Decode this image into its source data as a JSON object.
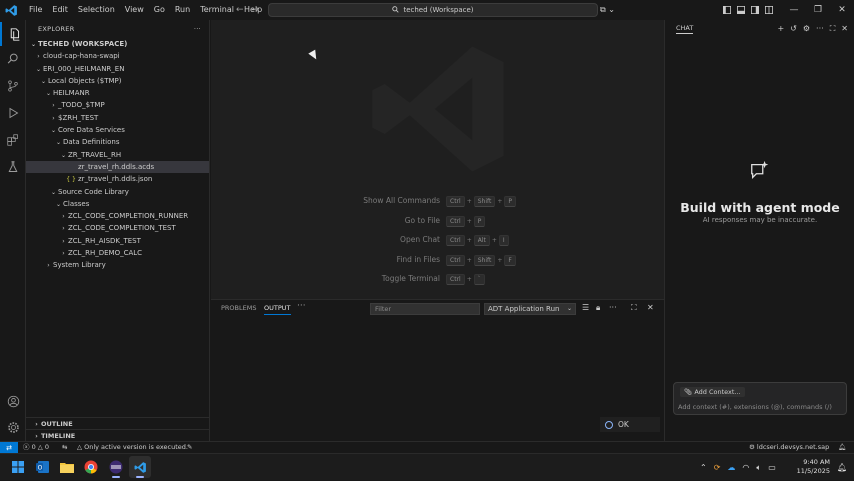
{
  "titlebar": {
    "menu": [
      "File",
      "Edit",
      "Selection",
      "View",
      "Go",
      "Run",
      "Terminal",
      "Help"
    ],
    "search_text": "teched (Workspace)"
  },
  "explorer": {
    "title": "EXPLORER",
    "workspace": "TECHED (WORKSPACE)",
    "items": [
      {
        "label": "cloud-cap-hana-swapi",
        "depth": 1,
        "chev": ">"
      },
      {
        "label": "ERI_000_HEILMANR_EN",
        "depth": 1,
        "chev": "v"
      },
      {
        "label": "Local Objects ($TMP)",
        "depth": 2,
        "chev": "v"
      },
      {
        "label": "HEILMANR",
        "depth": 3,
        "chev": "v"
      },
      {
        "label": "_TODO_$TMP",
        "depth": 4,
        "chev": ">"
      },
      {
        "label": "$ZRH_TEST",
        "depth": 4,
        "chev": ">"
      },
      {
        "label": "Core Data Services",
        "depth": 4,
        "chev": "v"
      },
      {
        "label": "Data Definitions",
        "depth": 5,
        "chev": "v"
      },
      {
        "label": "ZR_TRAVEL_RH",
        "depth": 6,
        "chev": "v"
      },
      {
        "label": "zr_travel_rh.ddls.acds",
        "depth": 7,
        "chev": "",
        "selected": true
      },
      {
        "label": "zr_travel_rh.ddls.json",
        "depth": 7,
        "chev": "",
        "json": true
      },
      {
        "label": "Source Code Library",
        "depth": 4,
        "chev": "v"
      },
      {
        "label": "Classes",
        "depth": 5,
        "chev": "v"
      },
      {
        "label": "ZCL_CODE_COMPLETION_RUNNER",
        "depth": 6,
        "chev": ">"
      },
      {
        "label": "ZCL_CODE_COMPLETION_TEST",
        "depth": 6,
        "chev": ">"
      },
      {
        "label": "ZCL_RH_AISDK_TEST",
        "depth": 6,
        "chev": ">"
      },
      {
        "label": "ZCL_RH_DEMO_CALC",
        "depth": 6,
        "chev": ">"
      },
      {
        "label": "System Library",
        "depth": 3,
        "chev": ">"
      }
    ],
    "outline": "OUTLINE",
    "timeline": "TIMELINE"
  },
  "editor": {
    "shortcuts": [
      {
        "label": "Show All Commands",
        "keys": [
          "Ctrl",
          "Shift",
          "P"
        ]
      },
      {
        "label": "Go to File",
        "keys": [
          "Ctrl",
          "P"
        ]
      },
      {
        "label": "Open Chat",
        "keys": [
          "Ctrl",
          "Alt",
          "I"
        ]
      },
      {
        "label": "Find in Files",
        "keys": [
          "Ctrl",
          "Shift",
          "F"
        ]
      },
      {
        "label": "Toggle Terminal",
        "keys": [
          "Ctrl",
          "`"
        ]
      }
    ]
  },
  "panel": {
    "tabs": [
      "PROBLEMS",
      "OUTPUT"
    ],
    "active_tab": "OUTPUT",
    "filter_placeholder": "Filter",
    "channel": "ADT Application Run"
  },
  "chat": {
    "title": "CHAT",
    "heading": "Build with agent mode",
    "subtext": "AI responses may be inaccurate.",
    "add_context": "Add Context...",
    "input_placeholder": "Add context (#), extensions (@), commands (/)"
  },
  "toast": {
    "label": "OK"
  },
  "status": {
    "problems": "0",
    "warnings": "0",
    "message": "Only active version is executed.",
    "host": "ldcseri.devsys.net.sap"
  },
  "taskbar": {
    "time": "9:40 AM",
    "date": "11/5/2025"
  },
  "colors": {
    "accent": "#0078d4",
    "background": "#181818",
    "editor": "#1f1f1f"
  }
}
